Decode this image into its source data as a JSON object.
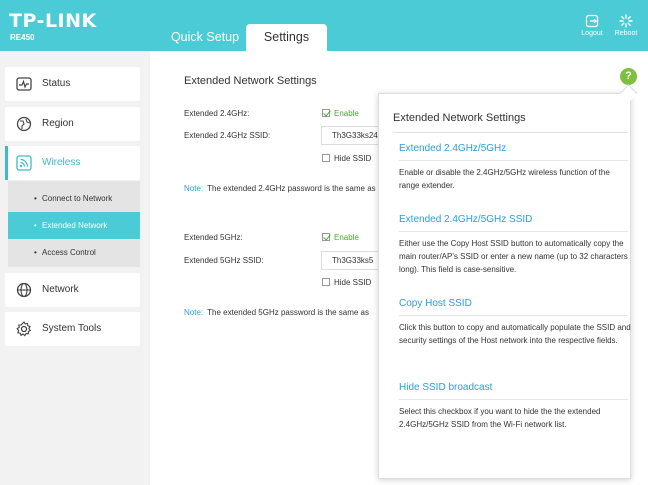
{
  "header": {
    "logo": "TP-LINK",
    "model": "RE450",
    "tabs": {
      "quick_setup": "Quick Setup",
      "settings": "Settings"
    },
    "logout_label": "Logout",
    "reboot_label": "Reboot",
    "accent": "#4acbd6"
  },
  "sidebar": {
    "items": {
      "status": "Status",
      "region": "Region",
      "wireless": "Wireless",
      "network": "Network",
      "system_tools": "System Tools"
    },
    "sub_items": {
      "connect": "Connect to Network",
      "extended": "Extended Network",
      "access": "Access Control"
    }
  },
  "main": {
    "title": "Extended Network Settings",
    "g24": {
      "label": "Extended 2.4GHz:",
      "enable": "Enable",
      "ssid_label": "Extended 2.4GHz SSID:",
      "ssid_value": "Th3G33ks24",
      "hide": "Hide SSID",
      "note_key": "Note:",
      "note": "The extended 2.4GHz password is the same as"
    },
    "g5": {
      "label": "Extended 5GHz:",
      "enable": "Enable",
      "ssid_label": "Extended 5GHz SSID:",
      "ssid_value": "Th3G33ks5",
      "hide": "Hide SSID",
      "note_key": "Note:",
      "note": "The extended 5GHz password is the same as"
    },
    "help_icon": "?"
  },
  "help": {
    "title": "Extended Network Settings",
    "sections": [
      {
        "heading": "Extended 2.4GHz/5GHz",
        "text": "Enable or disable the 2.4GHz/5GHz wireless function of the range extender."
      },
      {
        "heading": "Extended 2.4GHz/5GHz SSID",
        "text": "Either use the Copy Host SSID button to automatically copy the main router/AP's SSID or enter a new name (up to 32 characters long). This field is case-sensitive."
      },
      {
        "heading": "Copy Host SSID",
        "text": "Click this button to copy and automatically populate the SSID and security settings of the Host network into the respective fields."
      },
      {
        "heading": "Hide SSID broadcast",
        "text": "Select this checkbox if you want to hide the the extended 2.4GHz/5GHz SSID from the Wi-Fi network list."
      }
    ]
  }
}
